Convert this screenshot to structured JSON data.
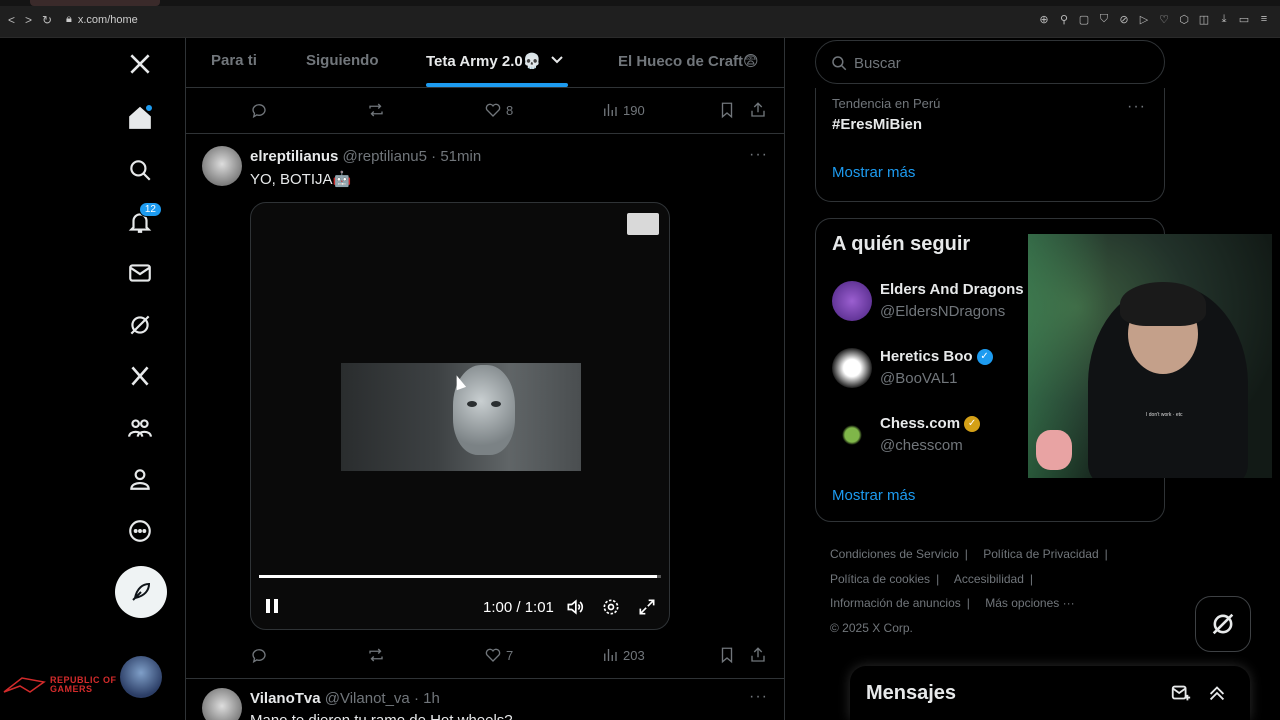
{
  "browser": {
    "url": "x.com/home",
    "nav_icons": [
      "back-icon",
      "forward-icon",
      "reload-icon",
      "lock-icon"
    ]
  },
  "left_nav": {
    "notifications_badge": "12",
    "items": [
      "x-logo-icon",
      "home-icon",
      "explore-icon",
      "notifications-icon",
      "messages-icon",
      "grok-icon",
      "premium-x-icon",
      "communities-icon",
      "profile-icon",
      "more-icon"
    ]
  },
  "overlay": {
    "rog_line1": "REPUBLIC OF",
    "rog_line2": "GAMERS"
  },
  "tabs": [
    {
      "label": "Para ti"
    },
    {
      "label": "Siguiendo"
    },
    {
      "label": "Teta Army 2.0💀"
    },
    {
      "label": "El Hueco de Craft😨"
    }
  ],
  "prev_tweet": {
    "likes": "8",
    "views": "190"
  },
  "tweet": {
    "name": "elreptilianus",
    "handle": "@reptilianu5",
    "time": "51min",
    "text": "YO, BOTIJA🤖",
    "video": {
      "time": "1:00 / 1:01",
      "progress": 0.99
    },
    "likes": "7",
    "views": "203"
  },
  "next_tweet": {
    "name": "VilanoTva",
    "handle": "@Vilanot_va",
    "time": "1h",
    "text": "Mano te dieron tu ramo de Hot wheels?"
  },
  "search": {
    "placeholder": "Buscar"
  },
  "trending": {
    "context": "Tendencia en Perú",
    "name": "#EresMiBien",
    "show_more": "Mostrar más"
  },
  "who_to_follow": {
    "title": "A quién seguir",
    "accounts": [
      {
        "name": "Elders And Dragons",
        "handle": "@EldersNDragons"
      },
      {
        "name": "Heretics Boo",
        "handle": "@BooVAL1"
      },
      {
        "name": "Chess.com",
        "handle": "@chesscom"
      }
    ],
    "show_more": "Mostrar más"
  },
  "footer": {
    "terms": "Condiciones de Servicio",
    "privacy": "Política de Privacidad",
    "cookies": "Política de cookies",
    "accessibility": "Accesibilidad",
    "ads_info": "Información de anuncios",
    "more": "Más opciones ···",
    "copyright": "© 2025 X Corp."
  },
  "messages": {
    "title": "Mensajes"
  },
  "webcam": {
    "shirt_text": "I don't work · etc"
  },
  "colors": {
    "accent": "#1d9bf0",
    "bg": "#000000",
    "muted": "#71767b",
    "text": "#e7e9ea"
  }
}
